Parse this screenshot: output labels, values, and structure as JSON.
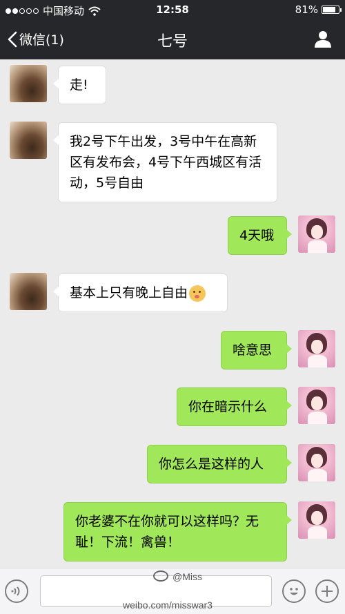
{
  "status_bar": {
    "carrier": "中国移动",
    "time": "12:58",
    "battery": "81%",
    "battery_level": 0.81
  },
  "nav": {
    "back_label": "微信(1)",
    "title": "七号"
  },
  "messages": [
    {
      "side": "in",
      "text": "走!"
    },
    {
      "side": "in",
      "text": "我2号下午出发，3号中午在高新区有发布会，4号下午西城区有活动，5号自由"
    },
    {
      "side": "out",
      "text": "4天哦"
    },
    {
      "side": "in",
      "text": "基本上只有晚上自由",
      "emoji": "kissing-face-emoji"
    },
    {
      "side": "out",
      "text": "啥意思"
    },
    {
      "side": "out",
      "text": "你在暗示什么"
    },
    {
      "side": "out",
      "text": "你怎么是这样的人"
    },
    {
      "side": "out",
      "text": "你老婆不在你就可以这样吗？无耻！下流！禽兽！"
    }
  ],
  "watermark": {
    "handle": "@Miss",
    "url": "weibo.com/misswar3"
  },
  "colors": {
    "nav_bg": "#25272b",
    "chat_bg": "#ebebeb",
    "bubble_out": "#a0e75a",
    "bubble_in": "#ffffff"
  }
}
